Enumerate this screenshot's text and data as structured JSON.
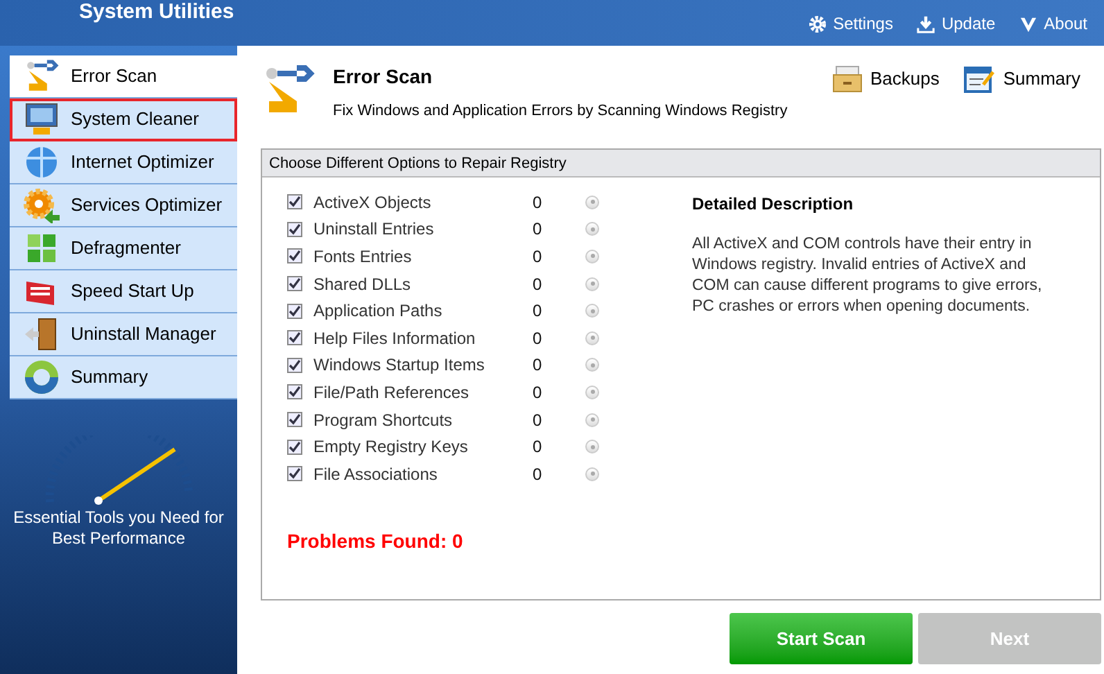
{
  "app_title": "System Utilities",
  "top_links": [
    {
      "kind": "gear",
      "label": "Settings"
    },
    {
      "kind": "download",
      "label": "Update"
    },
    {
      "kind": "chevron",
      "label": "About"
    }
  ],
  "sidebar": {
    "items": [
      {
        "kind": "scan",
        "label": "Error Scan",
        "selected": true,
        "highlighted": false
      },
      {
        "kind": "monitor",
        "label": "System Cleaner",
        "selected": false,
        "highlighted": true
      },
      {
        "kind": "globe",
        "label": "Internet Optimizer",
        "selected": false,
        "highlighted": false
      },
      {
        "kind": "cog",
        "label": "Services Optimizer",
        "selected": false,
        "highlighted": false
      },
      {
        "kind": "grid",
        "label": "Defragmenter",
        "selected": false,
        "highlighted": false
      },
      {
        "kind": "speed",
        "label": "Speed Start Up",
        "selected": false,
        "highlighted": false
      },
      {
        "kind": "door",
        "label": "Uninstall Manager",
        "selected": false,
        "highlighted": false
      },
      {
        "kind": "donut",
        "label": "Summary",
        "selected": false,
        "highlighted": false
      }
    ],
    "tagline": "Essential Tools you Need for Best Performance"
  },
  "header": {
    "title": "Error Scan",
    "subtitle": "Fix Windows and Application Errors by Scanning Windows Registry",
    "actions": [
      {
        "kind": "drawer",
        "label": "Backups"
      },
      {
        "kind": "note",
        "label": "Summary"
      }
    ]
  },
  "options_panel": {
    "title": "Choose Different Options to Repair Registry",
    "options": [
      {
        "label": "ActiveX Objects",
        "count": "0",
        "checked": true
      },
      {
        "label": "Uninstall Entries",
        "count": "0",
        "checked": true
      },
      {
        "label": "Fonts Entries",
        "count": "0",
        "checked": true
      },
      {
        "label": "Shared DLLs",
        "count": "0",
        "checked": true
      },
      {
        "label": "Application Paths",
        "count": "0",
        "checked": true
      },
      {
        "label": "Help Files Information",
        "count": "0",
        "checked": true
      },
      {
        "label": "Windows Startup Items",
        "count": "0",
        "checked": true
      },
      {
        "label": "File/Path References",
        "count": "0",
        "checked": true
      },
      {
        "label": "Program Shortcuts",
        "count": "0",
        "checked": true
      },
      {
        "label": "Empty Registry Keys",
        "count": "0",
        "checked": true
      },
      {
        "label": "File Associations",
        "count": "0",
        "checked": true
      }
    ],
    "description_title": "Detailed Description",
    "description": "All ActiveX and COM controls have their entry in Windows registry. Invalid entries of ActiveX and COM can cause different programs to give errors, PC crashes or errors when opening documents.",
    "problems": "Problems Found: 0"
  },
  "buttons": [
    {
      "label": "Start Scan",
      "disabled": false
    },
    {
      "label": "Next",
      "disabled": true
    }
  ]
}
